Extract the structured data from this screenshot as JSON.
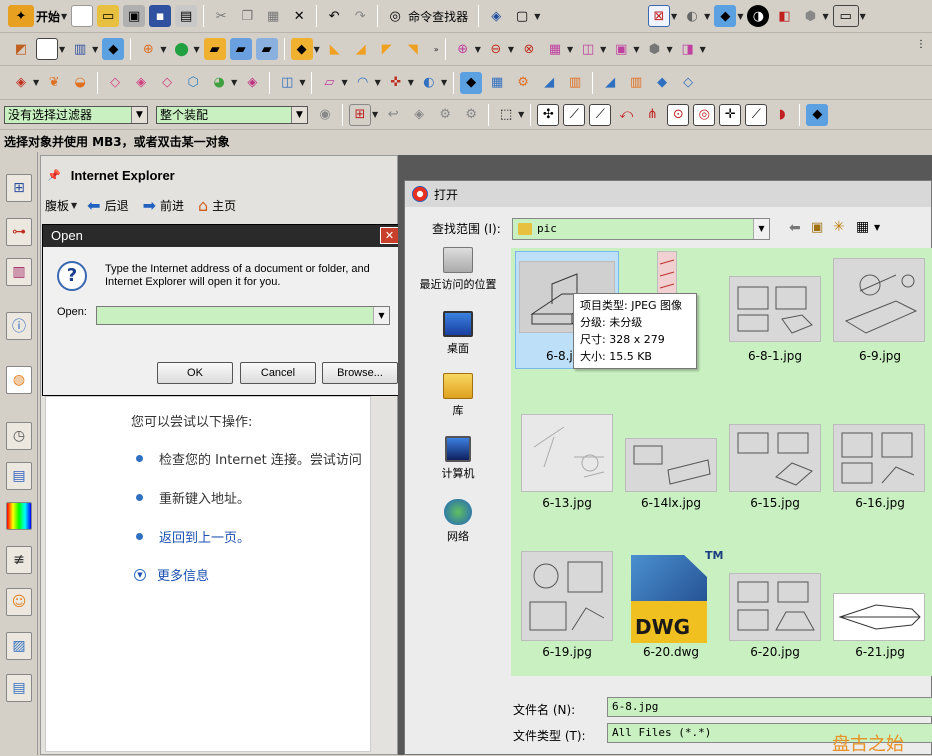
{
  "toolbar": {
    "start_label": "开始",
    "command_finder_label": "命令查找器"
  },
  "selection": {
    "filter_value": "没有选择过滤器",
    "assembly_value": "整个装配"
  },
  "prompt": "选择对象并使用 MB3，或者双击某一对象",
  "resource_bar": {
    "title": "Internet Explorer",
    "nav": {
      "favorites": "腹板",
      "back": "后退",
      "forward": "前进",
      "home": "主页"
    }
  },
  "open_dialog": {
    "title": "Open",
    "message": "Type the Internet address of a document or folder, and Internet Explorer will open it for you.",
    "open_label": "Open:",
    "open_value": "",
    "ok": "OK",
    "cancel": "Cancel",
    "browse": "Browse..."
  },
  "error_page": {
    "heading": "您可以尝试以下操作:",
    "items": [
      "检查您的 Internet 连接。尝试访问",
      "重新键入地址。",
      "返回到上一页。",
      "更多信息"
    ]
  },
  "file_dialog": {
    "title": "打开",
    "look_in_label": "查找范围 (I):",
    "look_in_value": "pic",
    "places": [
      "最近访问的位置",
      "桌面",
      "库",
      "计算机",
      "网络"
    ],
    "files": [
      {
        "name": "6-8.jpg"
      },
      {
        "name": ""
      },
      {
        "name": "6-8-1.jpg"
      },
      {
        "name": "6-9.jpg"
      },
      {
        "name": "6-13.jpg"
      },
      {
        "name": "6-14lx.jpg"
      },
      {
        "name": "6-15.jpg"
      },
      {
        "name": "6-16.jpg"
      },
      {
        "name": "6-19.jpg"
      },
      {
        "name": "6-20.dwg"
      },
      {
        "name": "6-20.jpg"
      },
      {
        "name": "6-21.jpg"
      }
    ],
    "tooltip": {
      "type": "项目类型: JPEG 图像",
      "rating": "分级: 未分级",
      "size": "尺寸: 328 x 279",
      "filesize": "大小: 15.5 KB"
    },
    "dwg_badge": "DWG",
    "tm": "TM",
    "filename_label": "文件名 (N):",
    "filename_value": "6-8.jpg",
    "filetype_label": "文件类型 (T):",
    "filetype_value": "All Files (*.*)"
  },
  "watermark": "盘古之始",
  "colors": {
    "accent": "#c8f0c0",
    "selection": "#cce8ff",
    "titlebar": "#2a2a2a",
    "close": "#c8402c"
  }
}
